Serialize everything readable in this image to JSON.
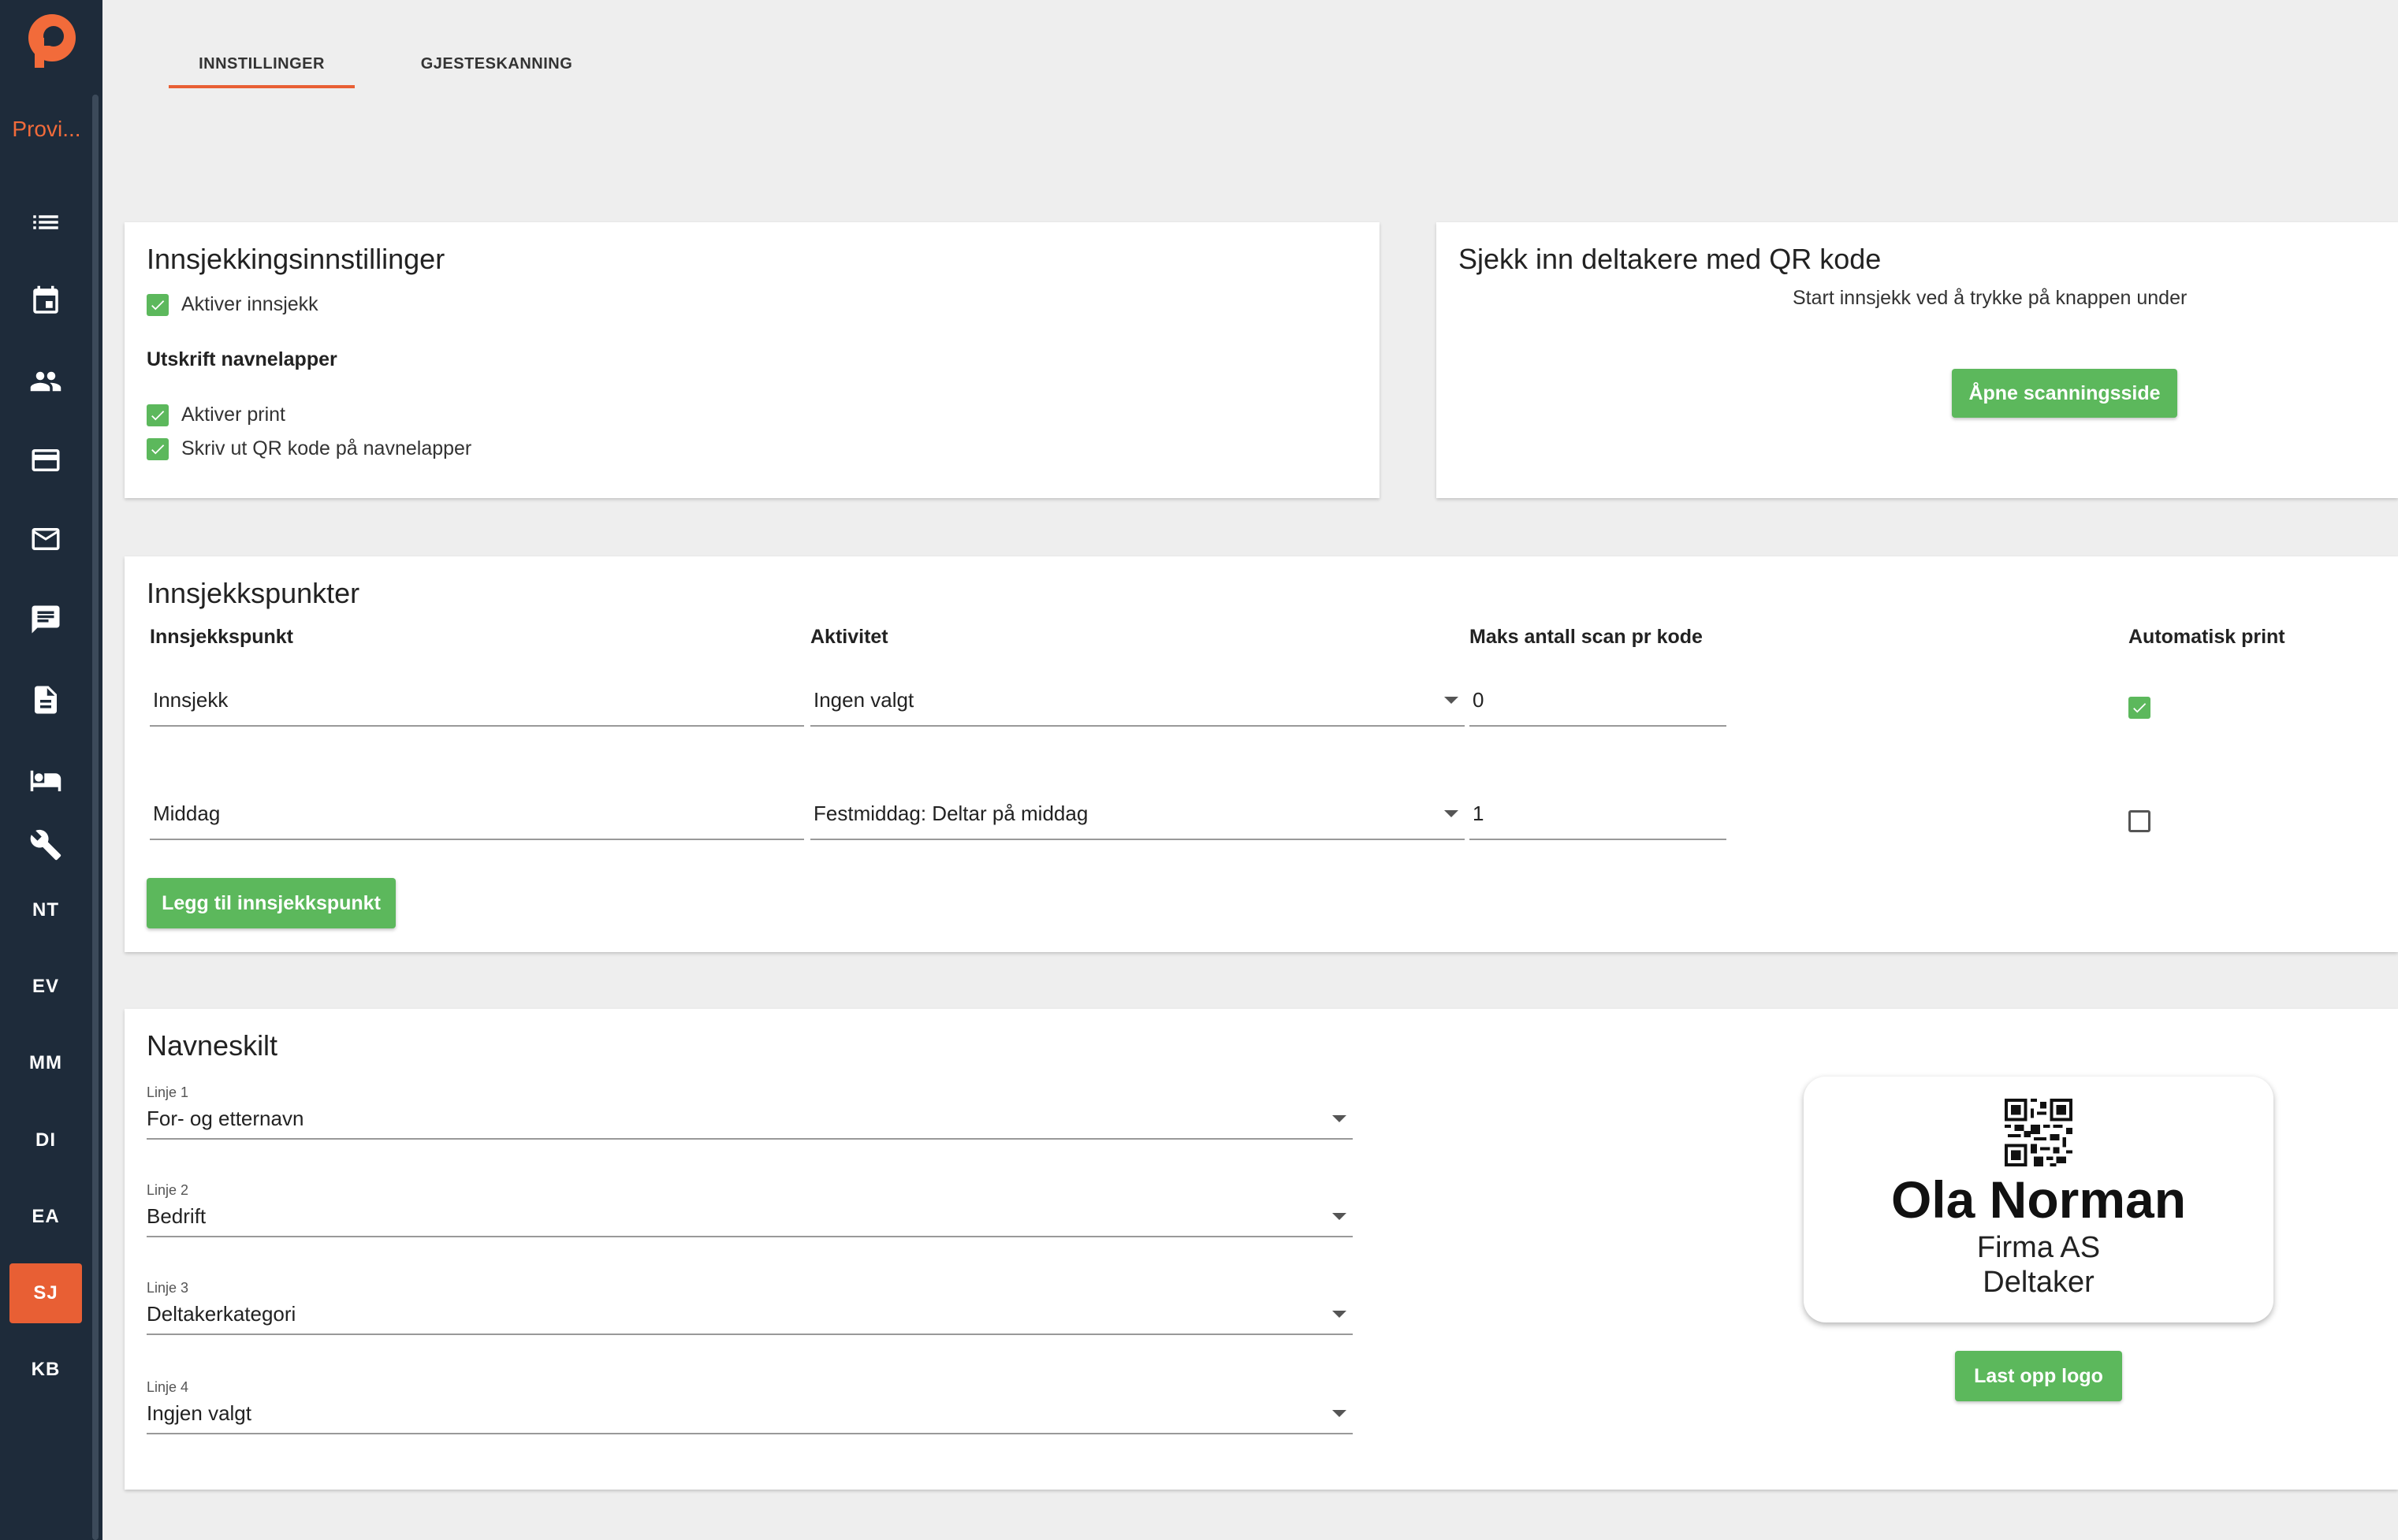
{
  "sidebar": {
    "org_name": "Provi...",
    "icons": [
      "list-icon",
      "calendar-icon",
      "people-icon",
      "credit-card-icon",
      "mail-icon",
      "chat-icon",
      "document-icon",
      "hotel-icon",
      "wrench-icon"
    ],
    "items": [
      "NT",
      "EV",
      "MM",
      "DI",
      "EA",
      "SJ",
      "KB"
    ],
    "active_item": "SJ"
  },
  "tabs": [
    {
      "label": "INNSTILLINGER",
      "active": true
    },
    {
      "label": "GJESTESKANNING",
      "active": false
    }
  ],
  "checkin_settings": {
    "title": "Innsjekkingsinnstillinger",
    "enable_checkin": {
      "label": "Aktiver innsjekk",
      "checked": true
    },
    "print_section_title": "Utskrift navnelapper",
    "enable_print": {
      "label": "Aktiver print",
      "checked": true
    },
    "print_qr": {
      "label": "Skriv ut QR kode på navnelapper",
      "checked": true
    }
  },
  "qr_checkin": {
    "title": "Sjekk inn deltakere med QR kode",
    "hint": "Start innsjekk ved å trykke på knappen under",
    "button": "Åpne scanningsside"
  },
  "checkpoints": {
    "title": "Innsjekkspunkter",
    "columns": [
      "Innsjekkspunkt",
      "Aktivitet",
      "Maks antall scan pr kode",
      "Automatisk print"
    ],
    "rows": [
      {
        "name": "Innsjekk",
        "activity": "Ingen valgt",
        "max_scan": "0",
        "auto_print": true
      },
      {
        "name": "Middag",
        "activity": "Festmiddag: Deltar på middag",
        "max_scan": "1",
        "auto_print": false
      }
    ],
    "add_button": "Legg til innsjekkspunkt"
  },
  "nametag": {
    "title": "Navneskilt",
    "lines": [
      {
        "label": "Linje 1",
        "value": "For- og etternavn"
      },
      {
        "label": "Linje 2",
        "value": "Bedrift"
      },
      {
        "label": "Linje 3",
        "value": "Deltakerkategori"
      },
      {
        "label": "Linje 4",
        "value": "Ingjen valgt"
      }
    ],
    "preview": {
      "name": "Ola Norman",
      "line2": "Firma AS",
      "line3": "Deltaker"
    },
    "upload_button": "Last opp logo"
  },
  "colors": {
    "accent": "#e85f34",
    "success": "#5cb85c",
    "sidebar": "#1e2b3a"
  }
}
